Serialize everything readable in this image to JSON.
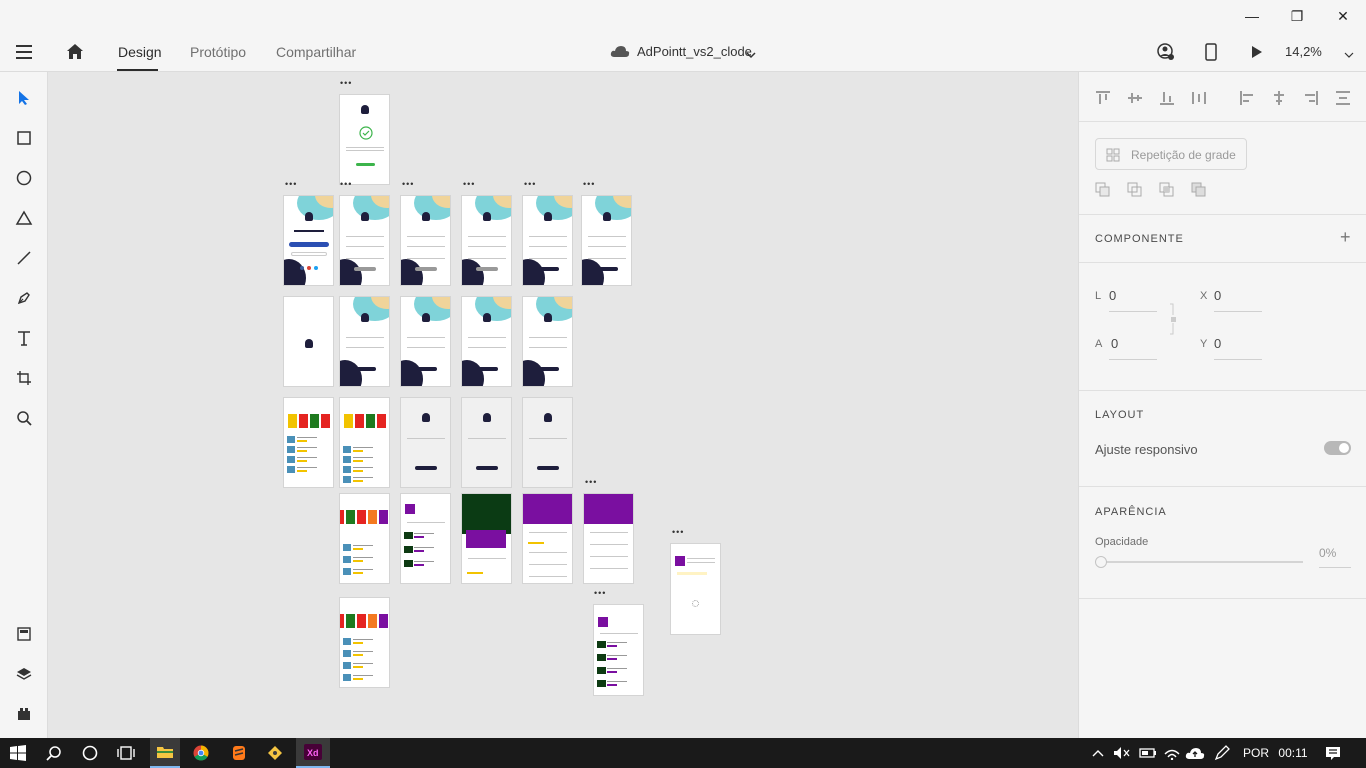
{
  "window": {
    "minimize_glyph": "—",
    "restore_glyph": "❐",
    "close_glyph": "✕"
  },
  "topbar": {
    "tabs": [
      {
        "label": "Design",
        "active": true
      },
      {
        "label": "Protótipo",
        "active": false
      },
      {
        "label": "Compartilhar",
        "active": false
      }
    ],
    "document_title": "AdPointt_vs2_clode",
    "zoom": "14,2%"
  },
  "tools": [
    "select-tool",
    "rectangle-tool",
    "ellipse-tool",
    "polygon-tool",
    "line-tool",
    "pen-tool",
    "text-tool",
    "artboard-tool",
    "zoom-tool",
    "assets-panel-icon",
    "layers-panel-icon",
    "plugins-panel-icon"
  ],
  "right_panel": {
    "repeat_grid_label": "Repetição de grade",
    "component_title": "COMPONENTE",
    "component_add": "+",
    "l_label": "L",
    "l_value": "0",
    "x_label": "X",
    "x_value": "0",
    "a_label": "A",
    "a_value": "0",
    "y_label": "Y",
    "y_value": "0",
    "layout_title": "LAYOUT",
    "responsive_label": "Ajuste responsivo",
    "responsive_on": true,
    "appearance_title": "APARÊNCIA",
    "opacity_label": "Opacidade",
    "opacity_value": "0%"
  },
  "canvas": {
    "artboard_dots": "•••"
  },
  "taskbar": {
    "language": "POR",
    "time": "00:11"
  },
  "colors": {
    "accent_blue": "#1473e6",
    "purple": "#7a0fa0",
    "navy": "#1e1e3c",
    "teal": "#7fd3d9"
  }
}
